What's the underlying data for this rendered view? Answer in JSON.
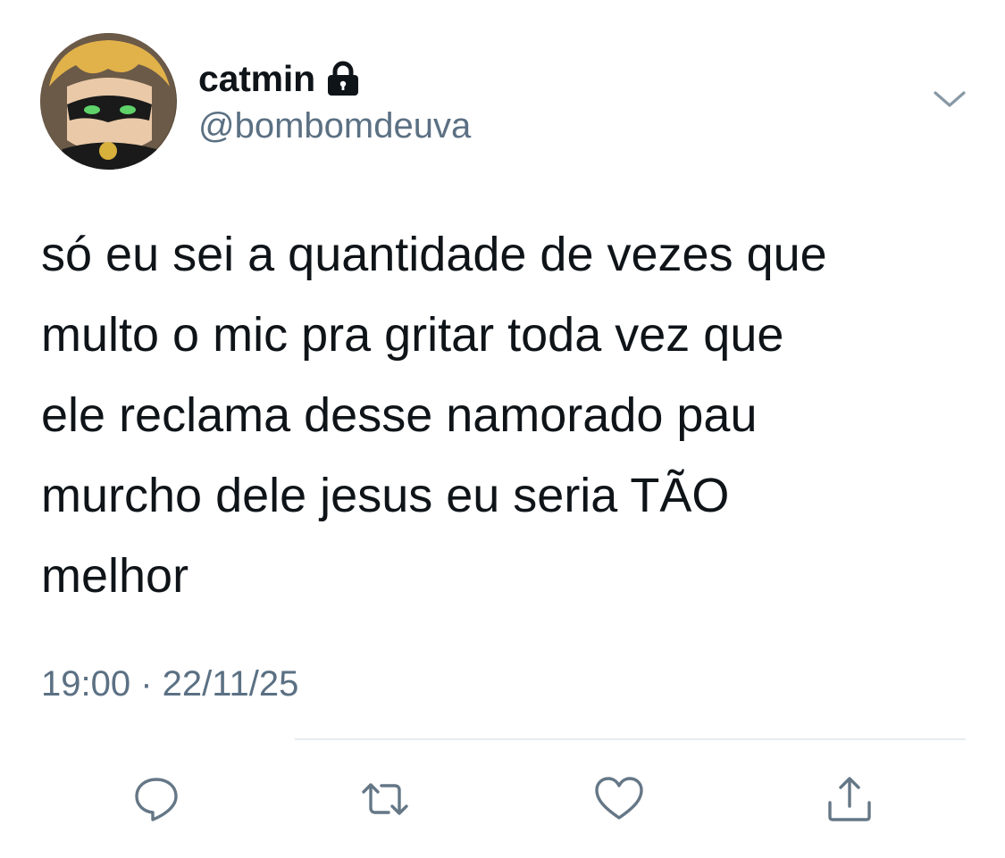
{
  "tweet": {
    "display_name": "catmin",
    "handle": "@bombomdeuva",
    "text": "só eu sei a quantidade de vezes que\nmulto o mic pra gritar toda vez que\nele reclama desse namorado pau\nmurcho dele jesus eu seria TÃO\nmelhor",
    "time": "19:00",
    "separator": " · ",
    "date": "22/11/25"
  },
  "icons": {
    "protected": "lock-icon",
    "menu": "chevron-down-icon",
    "reply": "reply-icon",
    "retweet": "retweet-icon",
    "like": "heart-icon",
    "share": "share-icon"
  },
  "colors": {
    "text": "#0f1419",
    "secondary": "#5b7083",
    "action_icon": "#657786",
    "divider": "#e6ecf0"
  }
}
